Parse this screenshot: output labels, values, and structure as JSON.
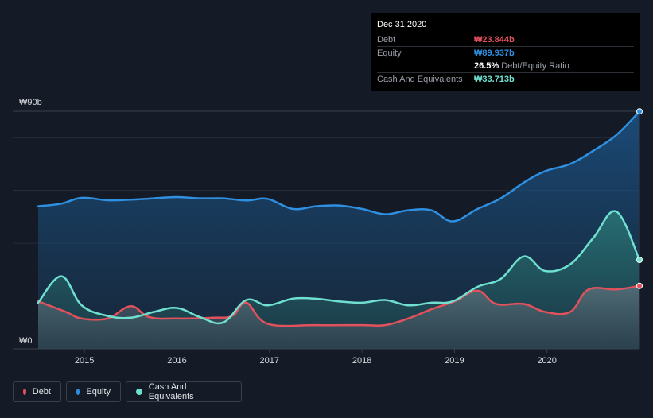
{
  "chart_data": {
    "type": "area",
    "currency": "₩",
    "y_tick_labels": [
      "₩0",
      "₩90b"
    ],
    "ylim": [
      0,
      90
    ],
    "xlim": [
      2014.5,
      2021.0
    ],
    "x_tick_labels": [
      "2015",
      "2016",
      "2017",
      "2018",
      "2019",
      "2020"
    ],
    "x_ticks": [
      2015,
      2016,
      2017,
      2018,
      2019,
      2020
    ],
    "grid": true,
    "legend_position": "bottom-left",
    "series": [
      {
        "name": "Debt",
        "color": "#e2515c",
        "points": [
          [
            2014.5,
            18
          ],
          [
            2014.8,
            14
          ],
          [
            2014.97,
            11.5
          ],
          [
            2015.25,
            11.5
          ],
          [
            2015.5,
            16.2
          ],
          [
            2015.7,
            12
          ],
          [
            2016.0,
            11.5
          ],
          [
            2016.4,
            11.8
          ],
          [
            2016.6,
            12.5
          ],
          [
            2016.75,
            17.5
          ],
          [
            2016.98,
            9.5
          ],
          [
            2017.5,
            9.0
          ],
          [
            2018.0,
            9.0
          ],
          [
            2018.25,
            9.0
          ],
          [
            2018.5,
            11.5
          ],
          [
            2018.75,
            15
          ],
          [
            2019.0,
            18
          ],
          [
            2019.25,
            22
          ],
          [
            2019.45,
            17
          ],
          [
            2019.75,
            17
          ],
          [
            2019.98,
            14
          ],
          [
            2020.25,
            14
          ],
          [
            2020.45,
            22.5
          ],
          [
            2020.75,
            22.5
          ],
          [
            2021.0,
            23.844
          ]
        ]
      },
      {
        "name": "Equity",
        "color": "#2f8fe0",
        "points": [
          [
            2014.5,
            54
          ],
          [
            2014.75,
            55
          ],
          [
            2014.97,
            57.2
          ],
          [
            2015.25,
            56.3
          ],
          [
            2015.5,
            56.5
          ],
          [
            2015.75,
            57
          ],
          [
            2016.0,
            57.5
          ],
          [
            2016.25,
            57
          ],
          [
            2016.5,
            57
          ],
          [
            2016.75,
            56.2
          ],
          [
            2016.98,
            56.8
          ],
          [
            2017.25,
            53
          ],
          [
            2017.5,
            54
          ],
          [
            2017.75,
            54.3
          ],
          [
            2018.0,
            53
          ],
          [
            2018.25,
            51
          ],
          [
            2018.5,
            52.5
          ],
          [
            2018.75,
            52.5
          ],
          [
            2018.98,
            48.3
          ],
          [
            2019.25,
            53
          ],
          [
            2019.5,
            57
          ],
          [
            2019.75,
            63
          ],
          [
            2019.98,
            67.3
          ],
          [
            2020.25,
            70
          ],
          [
            2020.5,
            75
          ],
          [
            2020.75,
            81
          ],
          [
            2021.0,
            89.937
          ]
        ]
      },
      {
        "name": "Cash And Equivalents",
        "color": "#6fe0d0",
        "points": [
          [
            2014.5,
            17.5
          ],
          [
            2014.75,
            27.5
          ],
          [
            2014.97,
            16.5
          ],
          [
            2015.25,
            12.5
          ],
          [
            2015.5,
            11.8
          ],
          [
            2015.75,
            14
          ],
          [
            2016.0,
            15.5
          ],
          [
            2016.25,
            12
          ],
          [
            2016.5,
            10
          ],
          [
            2016.75,
            18.5
          ],
          [
            2016.98,
            16.5
          ],
          [
            2017.25,
            19
          ],
          [
            2017.5,
            19
          ],
          [
            2017.75,
            18
          ],
          [
            2018.0,
            17.5
          ],
          [
            2018.25,
            18.5
          ],
          [
            2018.5,
            16.5
          ],
          [
            2018.75,
            17.5
          ],
          [
            2018.98,
            18
          ],
          [
            2019.25,
            23.5
          ],
          [
            2019.5,
            26.5
          ],
          [
            2019.75,
            35
          ],
          [
            2019.98,
            29.5
          ],
          [
            2020.25,
            32
          ],
          [
            2020.5,
            42
          ],
          [
            2020.75,
            52
          ],
          [
            2021.0,
            33.713
          ]
        ]
      }
    ]
  },
  "tooltip": {
    "date": "Dec 31 2020",
    "debt_label": "Debt",
    "debt_value": "₩23.844b",
    "equity_label": "Equity",
    "equity_value": "₩89.937b",
    "ratio_value": "26.5%",
    "ratio_label": "Debt/Equity Ratio",
    "cash_label": "Cash And Equivalents",
    "cash_value": "₩33.713b"
  },
  "legend": {
    "debt": "Debt",
    "equity": "Equity",
    "cash": "Cash And Equivalents"
  },
  "colors": {
    "background": "#151b26",
    "debt": "#e2515c",
    "equity": "#2f8fe0",
    "cash": "#6fe0d0"
  }
}
